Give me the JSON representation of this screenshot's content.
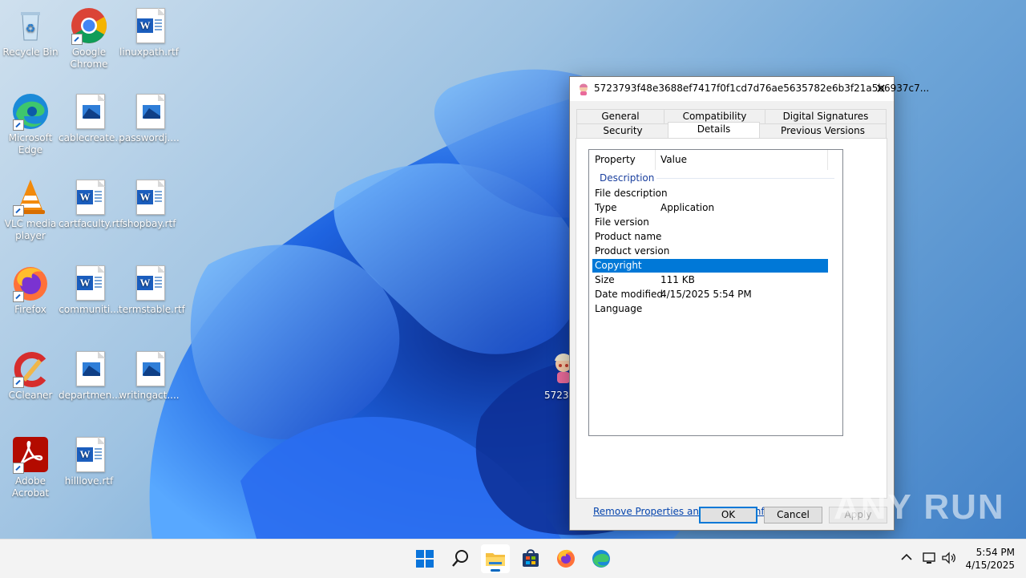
{
  "desktop": {
    "icons": [
      {
        "label": "Recycle Bin",
        "icon": "recycle-bin-icon"
      },
      {
        "label": "Google Chrome",
        "icon": "chrome-icon"
      },
      {
        "label": "linuxpath.rtf",
        "icon": "word-document-icon"
      },
      {
        "label": "Microsoft Edge",
        "icon": "edge-icon"
      },
      {
        "label": "cablecreate...",
        "icon": "image-file-icon"
      },
      {
        "label": "passwordj....",
        "icon": "image-file-icon"
      },
      {
        "label": "VLC media player",
        "icon": "vlc-icon"
      },
      {
        "label": "cartfaculty.rtf",
        "icon": "word-document-icon"
      },
      {
        "label": "shopbay.rtf",
        "icon": "word-document-icon"
      },
      {
        "label": "Firefox",
        "icon": "firefox-icon"
      },
      {
        "label": "communiti...",
        "icon": "word-document-icon"
      },
      {
        "label": "termstable.rtf",
        "icon": "word-document-icon"
      },
      {
        "label": "CCleaner",
        "icon": "ccleaner-icon"
      },
      {
        "label": "departmen...",
        "icon": "image-file-icon"
      },
      {
        "label": "writingact....",
        "icon": "image-file-icon"
      },
      {
        "label": "Adobe Acrobat",
        "icon": "acrobat-icon"
      },
      {
        "label": "hilllove.rtf",
        "icon": "word-document-icon"
      },
      {
        "label": "5723",
        "icon": "executable-icon"
      }
    ]
  },
  "dialog": {
    "title": "5723793f48e3688ef7417f0f1cd7d76ae5635782e6b3f21a5b6937c7...",
    "close_glyph": "✕",
    "tabs": [
      {
        "label": "General"
      },
      {
        "label": "Compatibility"
      },
      {
        "label": "Digital Signatures"
      },
      {
        "label": "Security"
      },
      {
        "label": "Details",
        "active": true
      },
      {
        "label": "Previous Versions"
      }
    ],
    "columns": {
      "property": "Property",
      "value": "Value"
    },
    "group": "Description",
    "rows": [
      {
        "property": "File description",
        "value": ""
      },
      {
        "property": "Type",
        "value": "Application"
      },
      {
        "property": "File version",
        "value": ""
      },
      {
        "property": "Product name",
        "value": ""
      },
      {
        "property": "Product version",
        "value": ""
      },
      {
        "property": "Copyright",
        "value": "",
        "selected": true
      },
      {
        "property": "Size",
        "value": "111 KB"
      },
      {
        "property": "Date modified",
        "value": "4/15/2025 5:54 PM"
      },
      {
        "property": "Language",
        "value": ""
      }
    ],
    "remove_link": "Remove Properties and Personal Information",
    "buttons": {
      "ok": "OK",
      "cancel": "Cancel",
      "apply": "Apply"
    }
  },
  "taskbar": {
    "items": [
      "start-icon",
      "search-icon",
      "file-explorer-icon",
      "store-icon",
      "firefox-icon",
      "edge-icon"
    ],
    "tray_chevron": "^",
    "time": "5:54 PM",
    "date": "4/15/2025"
  },
  "watermark": "ANY RUN",
  "colors": {
    "accent": "#0078d7",
    "selection": "#0078d7",
    "link": "#0645ad"
  }
}
